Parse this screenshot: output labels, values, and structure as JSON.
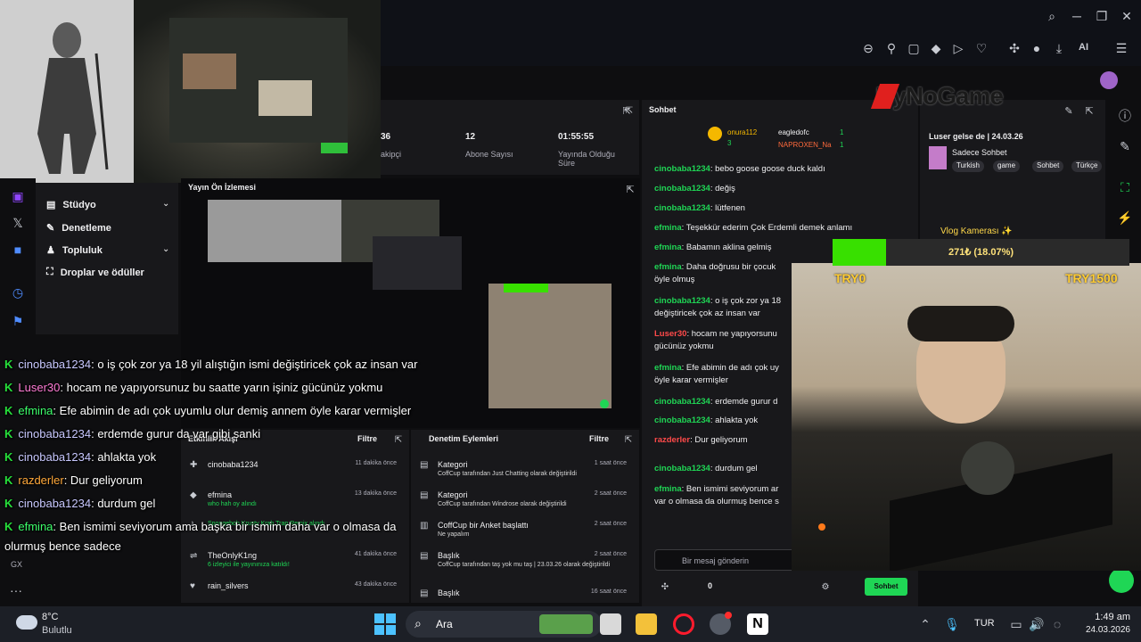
{
  "browser": {
    "ai_label": "AI"
  },
  "brand": {
    "logo_text": "ByNoGame"
  },
  "nav": {
    "items": [
      {
        "label": "Stüdyo"
      },
      {
        "label": "Denetleme"
      },
      {
        "label": "Topluluk"
      },
      {
        "label": "Droplar ve ödüller"
      }
    ]
  },
  "stats": {
    "items": [
      {
        "value": "36",
        "label": "akipçi"
      },
      {
        "value": "12",
        "label": "Abone Sayısı"
      },
      {
        "value": "01:55:55",
        "label": "Yayında Olduğu Süre"
      }
    ]
  },
  "preview": {
    "title": "Yayın Ön İzlemesi"
  },
  "overlay_chat": [
    {
      "user": "cinobaba1234",
      "text": ": o iş çok zor ya 18 yil alıştığın ismi değiştiricek çok az insan var",
      "color": "#c8c8ff"
    },
    {
      "user": "Luser30",
      "text": ": hocam ne yapıyorsunuz bu saatte yarın işiniz gücünüz yokmu",
      "color": "#ff7bd5"
    },
    {
      "user": "efmina",
      "text": ": Efe abimin de adı çok uyumlu olur demiş annem öyle karar vermişler",
      "color": "#3cff6b"
    },
    {
      "user": "cinobaba1234",
      "text": ": erdemde gurur da var gibi sanki",
      "color": "#c8c8ff"
    },
    {
      "user": "cinobaba1234",
      "text": ": ahlakta yok",
      "color": "#c8c8ff"
    },
    {
      "user": "razderler",
      "text": ": Dur geliyorum",
      "color": "#ffa83a"
    },
    {
      "user": "cinobaba1234",
      "text": ": durdum gel",
      "color": "#c8c8ff"
    },
    {
      "user": "efmina",
      "text": ": Ben ismimi seviyorum ama başka bir ismim daha var o olmasa da",
      "color": "#3cff6b"
    },
    {
      "user": "",
      "text": "olurmuş bence sadece",
      "color": "#ffffff"
    }
  ],
  "activity": {
    "title": "Etkinlik Akışı",
    "filter": "Filtre",
    "rows": [
      {
        "name": "cinobaba1234",
        "sub": "",
        "time": "11 dakika önce"
      },
      {
        "name": "efmina",
        "sub": "who hah oy alındı",
        "time": "13 dakika önce"
      },
      {
        "name": "",
        "sub": "Spongebob Krusty Krab Trap Remix alındı",
        "time": ""
      },
      {
        "name": "TheOnlyK1ng",
        "sub": "6 izleyici ile yayınınıza katıldı!",
        "time": "41 dakika önce"
      },
      {
        "name": "rain_silvers",
        "sub": "",
        "time": "43 dakika önce"
      }
    ]
  },
  "modlog": {
    "title": "Denetim Eylemleri",
    "filter": "Filtre",
    "rows": [
      {
        "name": "Kategori",
        "sub": "CoffCup tarafından Just Chatting olarak değiştirildi",
        "time": "1 saat önce"
      },
      {
        "name": "Kategori",
        "sub": "CoffCup tarafından Windrose olarak değiştirildi",
        "time": "2 saat önce"
      },
      {
        "name": "CoffCup bir Anket başlattı",
        "sub": "Ne yapalım",
        "time": "2 saat önce"
      },
      {
        "name": "Başlık",
        "sub": "CoffCup tarafından taş yok mu taş | 23.03.26 olarak değiştirildi",
        "time": "2 saat önce"
      },
      {
        "name": "Başlık",
        "sub": "",
        "time": "16 saat önce"
      }
    ]
  },
  "chat": {
    "title": "Sohbet",
    "leaders": [
      {
        "name": "onura112",
        "badge": "3"
      },
      {
        "name": "eagledofc",
        "badge": "1"
      },
      {
        "name": "NAPROXEN_Na",
        "badge": "1"
      }
    ],
    "messages": [
      {
        "user": "cinobaba1234",
        "text": ": bebo goose goose duck kaldı",
        "cls": "u-green"
      },
      {
        "user": "cinobaba1234",
        "text": ": değiş",
        "cls": "u-green"
      },
      {
        "user": "cinobaba1234",
        "text": ": lütfenen",
        "cls": "u-green"
      },
      {
        "user": "efmina",
        "text": ": Teşekkür ederim Çok Erdemli demek anlamı",
        "cls": "u-green"
      },
      {
        "user": "efmina",
        "text": ": Babamın aklina gelmiş",
        "cls": "u-green"
      },
      {
        "user": "efmina",
        "text": ": Daha doğrusu bir çocuk",
        "cls": "u-green"
      },
      {
        "user": "",
        "text": "öyle olmuş",
        "cls": ""
      },
      {
        "user": "cinobaba1234",
        "text": ": o iş çok zor ya 18",
        "cls": "u-green"
      },
      {
        "user": "",
        "text": "değiştiricek çok az insan var",
        "cls": ""
      },
      {
        "user": "Luser30",
        "text": ": hocam ne yapıyorsunu",
        "cls": "u-red"
      },
      {
        "user": "",
        "text": "gücünüz yokmu",
        "cls": ""
      },
      {
        "user": "efmina",
        "text": ": Efe abimin de adı çok uy",
        "cls": "u-green"
      },
      {
        "user": "",
        "text": "öyle karar vermişler",
        "cls": ""
      },
      {
        "user": "cinobaba1234",
        "text": ": erdemde gurur d",
        "cls": "u-green"
      },
      {
        "user": "cinobaba1234",
        "text": ": ahlakta yok",
        "cls": "u-green"
      },
      {
        "user": "razderler",
        "text": ": Dur geliyorum",
        "cls": "u-red"
      },
      {
        "user": "cinobaba1234",
        "text": ": durdum gel",
        "cls": "u-green"
      },
      {
        "user": "efmina",
        "text": ": Ben ismimi seviyorum ar",
        "cls": "u-green"
      },
      {
        "user": "",
        "text": "var o olmasa da olurmuş bence s",
        "cls": ""
      }
    ],
    "placeholder": "Bir mesaj gönderin",
    "count": "0",
    "send_label": "Sohbet"
  },
  "right": {
    "title": "Luser gelse de | 24.03.26",
    "channel": "Sadece Sohbet",
    "tags": [
      "Turkish",
      "game",
      "Sohbet",
      "Türkçe"
    ],
    "vlog_label": "Vlog Kamerası ✨"
  },
  "gauge": {
    "text": "271₺ (18.07%)",
    "fill": 0.1807,
    "left_label": "TRY0",
    "right_label": "TRY1500"
  },
  "taskbar": {
    "weather_temp": "8°C",
    "weather_desc": "Bulutlu",
    "search": "Ara",
    "lang": "TUR",
    "time": "1:49 am",
    "date": "24.03.2026"
  }
}
